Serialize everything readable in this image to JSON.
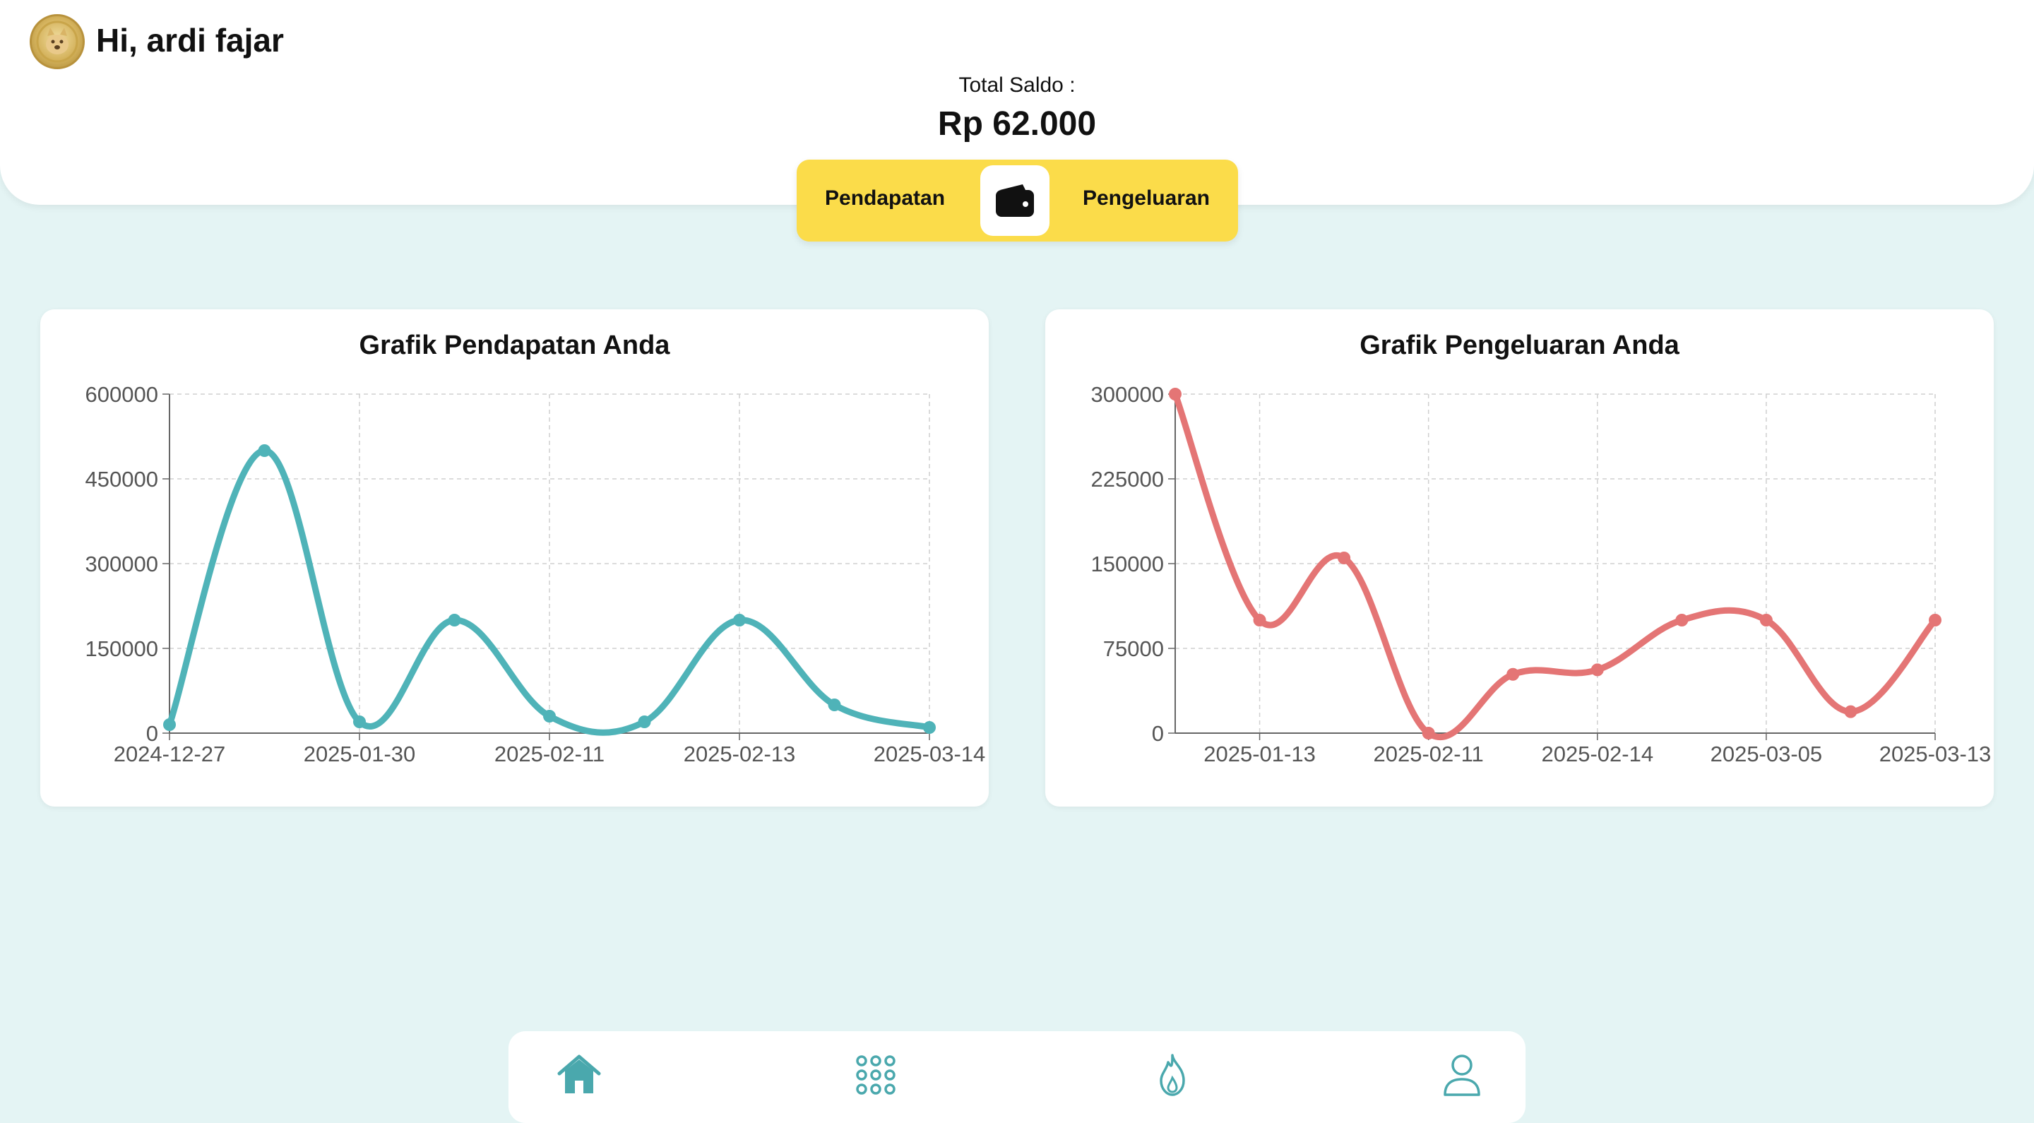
{
  "header": {
    "greeting": "Hi, ardi fajar",
    "saldo_label": "Total Saldo :",
    "saldo_value": "Rp 62.000"
  },
  "toggle": {
    "left_label": "Pendapatan",
    "right_label": "Pengeluaran",
    "icon": "wallet-icon"
  },
  "nav": {
    "items": [
      {
        "icon": "home-icon",
        "active": true
      },
      {
        "icon": "grid-icon",
        "active": false
      },
      {
        "icon": "fire-icon",
        "active": false
      },
      {
        "icon": "profile-icon",
        "active": false
      }
    ]
  },
  "colors": {
    "background": "#e4f4f4",
    "toggle": "#fbdc4a",
    "teal": "#4fb3b8",
    "red": "#e47575",
    "nav_icon": "#4aa8ad"
  },
  "chart_data": [
    {
      "type": "line",
      "title": "Grafik Pendapatan Anda",
      "x": [
        "2024-12-27",
        "",
        "2025-01-30",
        "",
        "2025-02-11",
        "",
        "2025-02-13",
        "",
        "2025-03-14"
      ],
      "tick_labels": [
        "2024-12-27",
        "2025-01-30",
        "2025-02-11",
        "2025-02-13",
        "2025-03-14"
      ],
      "values": [
        15000,
        500000,
        20000,
        200000,
        30000,
        20000,
        200000,
        50000,
        10000
      ],
      "yticks": [
        "600000",
        "450000",
        "300000",
        "150000",
        "0"
      ],
      "ylim": [
        0,
        600000
      ],
      "grid": true,
      "color": "#4fb3b8"
    },
    {
      "type": "line",
      "title": "Grafik Pengeluaran Anda",
      "x": [
        "",
        "2025-01-13",
        "",
        "2025-02-11",
        "",
        "2025-02-14",
        "",
        "2025-03-05",
        "",
        "2025-03-13"
      ],
      "tick_labels": [
        "2025-01-13",
        "2025-02-11",
        "2025-02-14",
        "2025-03-05",
        "2025-03-13"
      ],
      "values": [
        300000,
        100000,
        155000,
        0,
        52000,
        56000,
        100000,
        100000,
        19000,
        100000
      ],
      "yticks": [
        "300000",
        "225000",
        "150000",
        "75000",
        "0"
      ],
      "ylim": [
        0,
        300000
      ],
      "grid": true,
      "color": "#e47575"
    }
  ]
}
